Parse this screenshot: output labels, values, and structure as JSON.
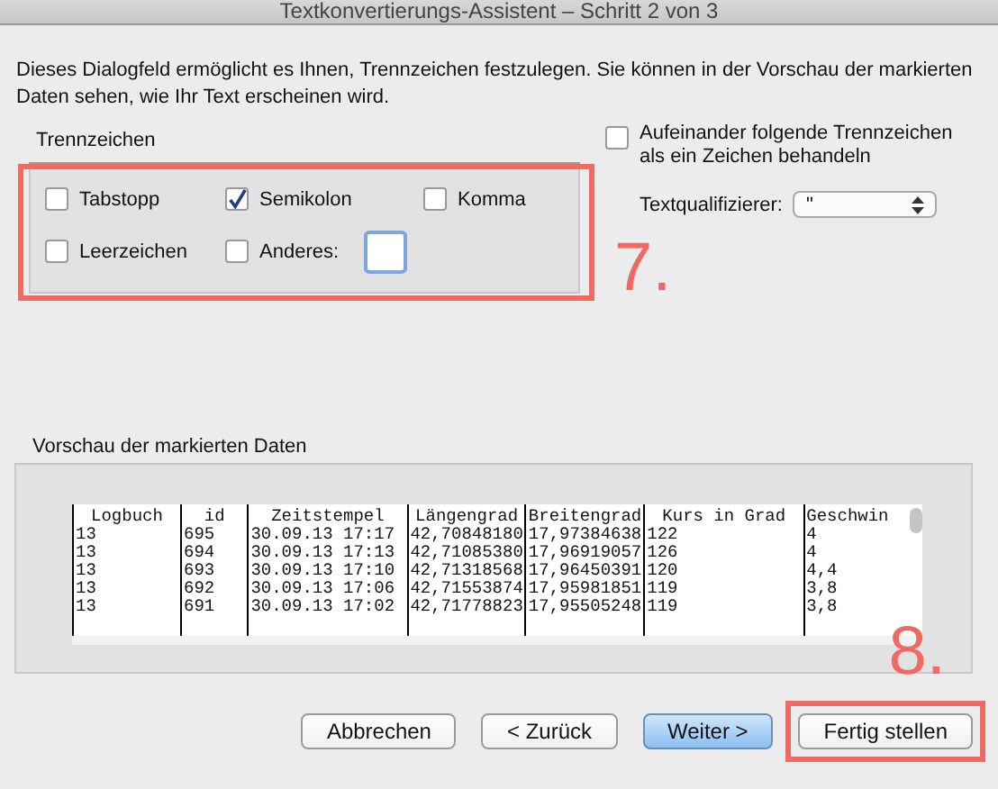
{
  "window": {
    "title": "Textkonvertierungs-Assistent – Schritt 2 von 3"
  },
  "intro": "Dieses Dialogfeld ermöglicht es Ihnen, Trennzeichen festzulegen. Sie können in der Vorschau der markierten Daten sehen, wie Ihr Text erscheinen wird.",
  "delimiters": {
    "title": "Trennzeichen",
    "options": [
      {
        "label": "Tabstopp",
        "checked": false
      },
      {
        "label": "Semikolon",
        "checked": true
      },
      {
        "label": "Komma",
        "checked": false
      },
      {
        "label": "Leerzeichen",
        "checked": false
      },
      {
        "label": "Anderes:",
        "checked": false
      }
    ]
  },
  "consecutive": {
    "label": "Aufeinander folgende Trennzeichen als ein Zeichen behandeln",
    "checked": false
  },
  "text_qualifier": {
    "label": "Textqualifizierer:",
    "value": "\""
  },
  "preview": {
    "title": "Vorschau der markierten Daten",
    "columns": [
      "Logbuch",
      "id",
      "Zeitstempel",
      "Längengrad",
      "Breitengrad",
      "Kurs in Grad",
      "Geschwin"
    ],
    "rows": [
      [
        "13",
        "695",
        "30.09.13 17:17",
        "42,70848180",
        "17,97384638",
        "122",
        "4"
      ],
      [
        "13",
        "694",
        "30.09.13 17:13",
        "42,71085380",
        "17,96919057",
        "126",
        "4"
      ],
      [
        "13",
        "693",
        "30.09.13 17:10",
        "42,71318568",
        "17,96450391",
        "120",
        "4,4"
      ],
      [
        "13",
        "692",
        "30.09.13 17:06",
        "42,71553874",
        "17,95981851",
        "119",
        "3,8"
      ],
      [
        "13",
        "691",
        "30.09.13 17:02",
        "42,71778823",
        "17,95505248",
        "119",
        "3,8"
      ]
    ]
  },
  "buttons": [
    {
      "label": "Abbrechen",
      "default": false
    },
    {
      "label": "< Zurück",
      "default": false
    },
    {
      "label": "Weiter >",
      "default": true
    },
    {
      "label": "Fertig stellen",
      "default": false
    }
  ],
  "annotations": [
    "7.",
    "8."
  ]
}
